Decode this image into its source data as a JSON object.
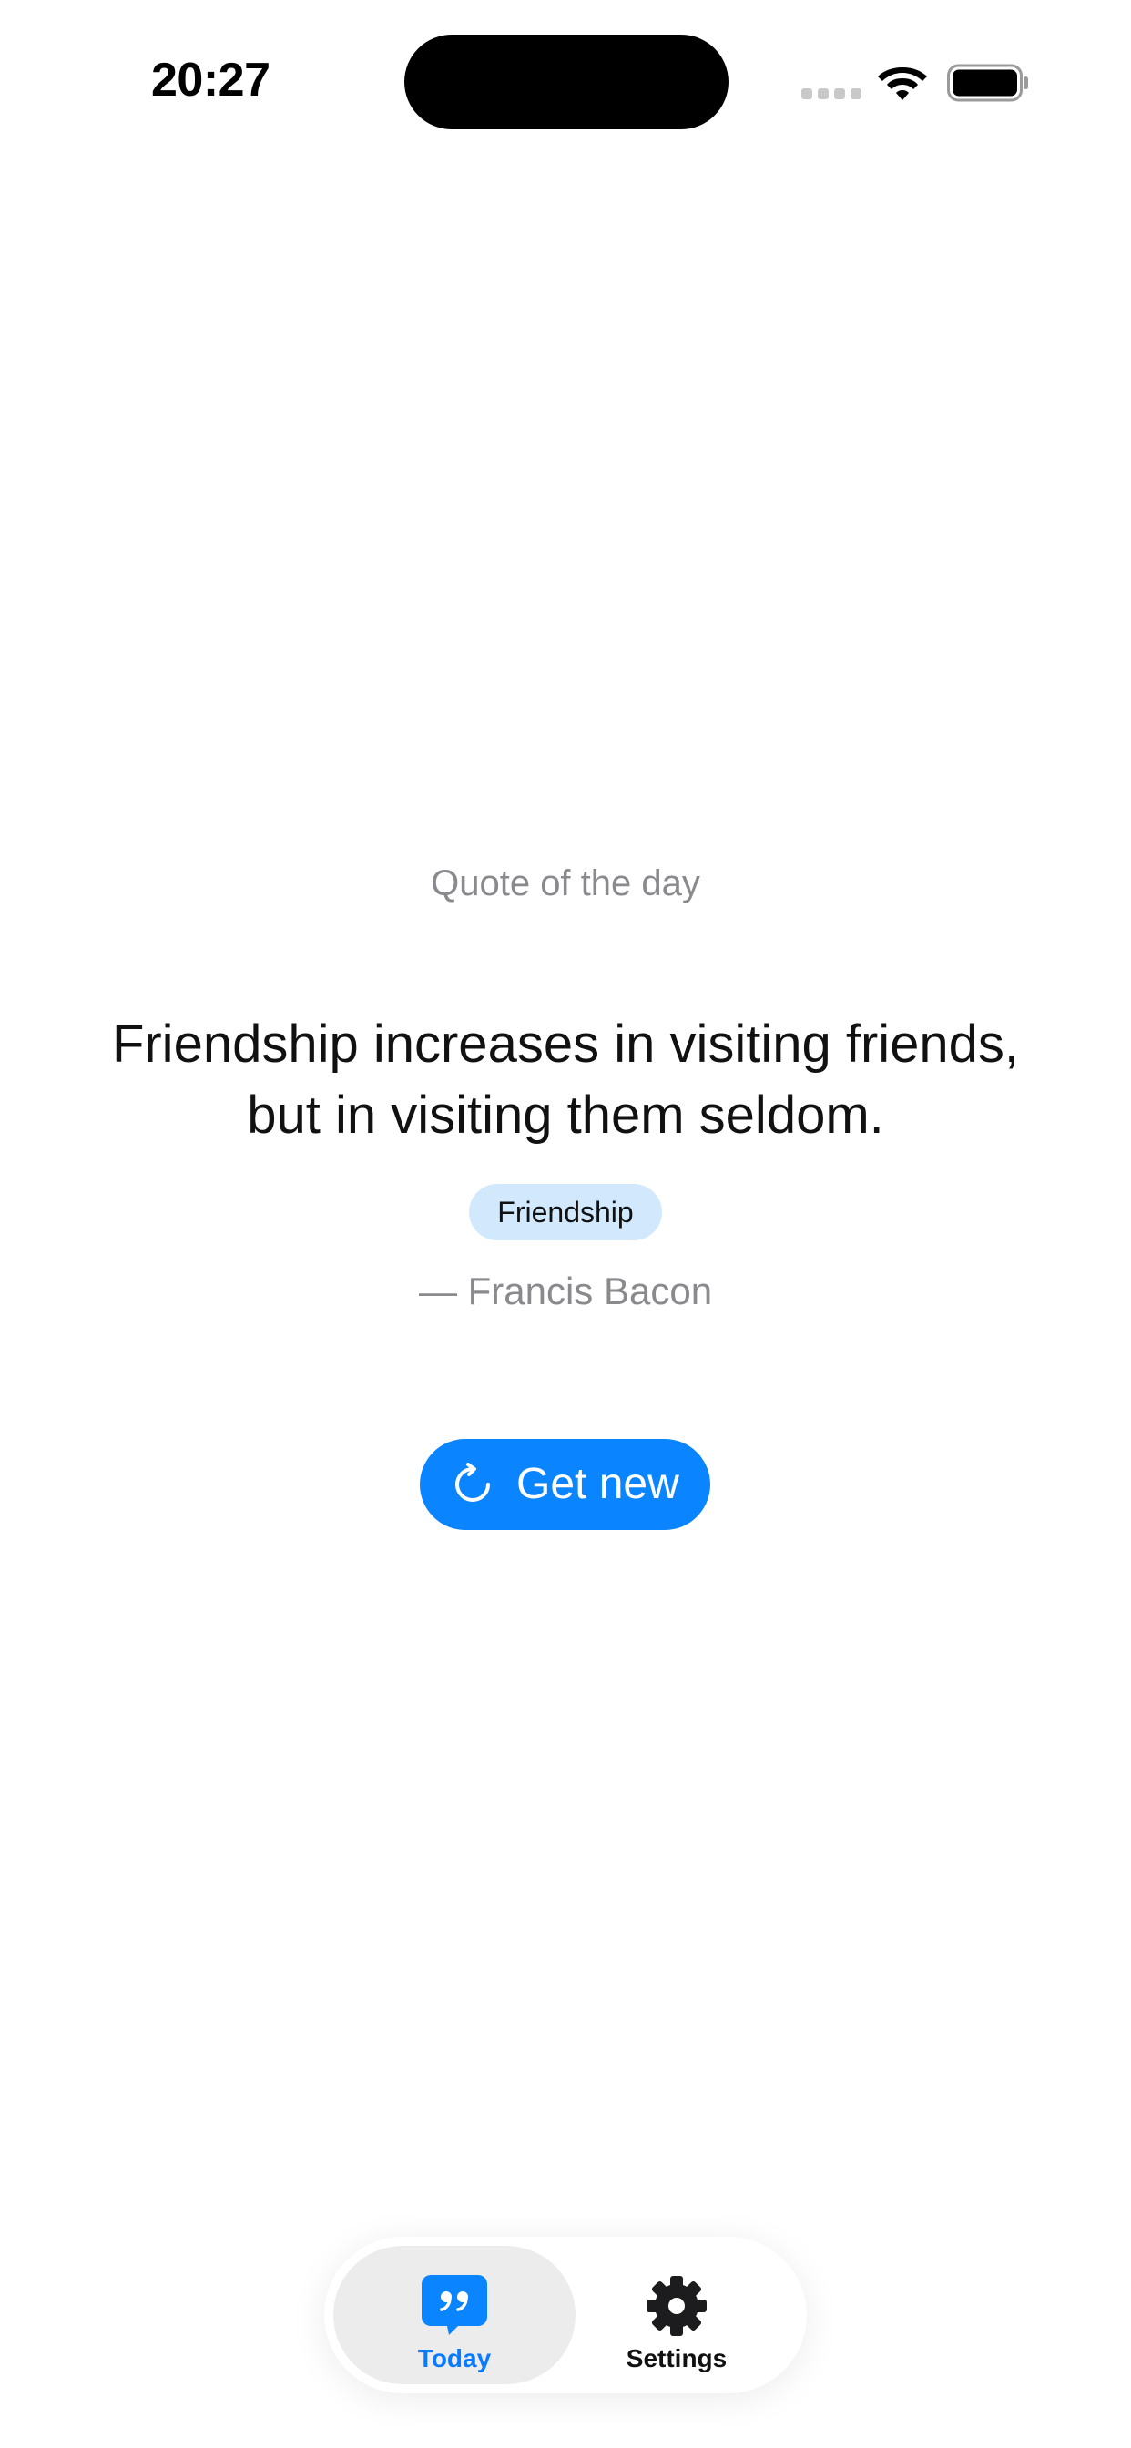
{
  "status_bar": {
    "time": "20:27",
    "icons": [
      "signal-icon",
      "wifi-icon",
      "battery-icon"
    ]
  },
  "main": {
    "section_label": "Quote of the day",
    "quote": "Friendship increases in visiting friends, but in visiting them seldom.",
    "tag": "Friendship",
    "author": "— Francis Bacon",
    "get_new_button": {
      "label": "Get new",
      "icon": "refresh-icon"
    }
  },
  "tab_bar": {
    "selected": "Today",
    "tabs": [
      {
        "label": "Today",
        "icon": "quote-bubble-icon"
      },
      {
        "label": "Settings",
        "icon": "gear-icon"
      }
    ]
  },
  "colors": {
    "accent": "#0a84ff",
    "tag_background": "#d2e8fd",
    "secondary_text": "#8a8a8e",
    "active_tab_background": "#ececec"
  }
}
